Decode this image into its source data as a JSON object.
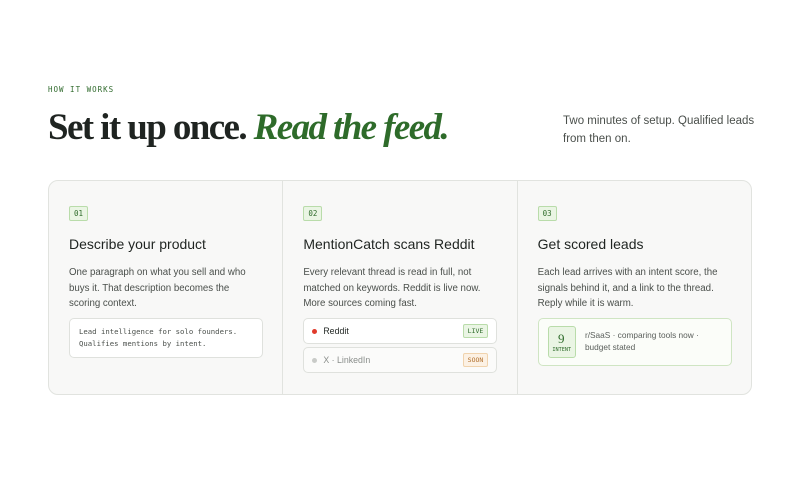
{
  "hero": {
    "eyebrow": "HOW IT WORKS",
    "title_plain": "Set it up once.",
    "title_accent": "Read the feed.",
    "subtext": "Two minutes of setup. Qualified leads from then on."
  },
  "steps": [
    {
      "number": "01",
      "title": "Describe your product",
      "description": "One paragraph on what you sell and who buys it. That description becomes the scoring context.",
      "example_line1": "Lead intelligence for solo founders.",
      "example_line2": "Qualifies mentions by intent."
    },
    {
      "number": "02",
      "title": "MentionCatch scans Reddit",
      "description": "Every relevant thread is read in full, not matched on keywords. Reddit is live now. More sources coming fast.",
      "sources": [
        {
          "label": "Reddit",
          "status": "LIVE"
        },
        {
          "label": "X · LinkedIn",
          "status": "SOON"
        }
      ]
    },
    {
      "number": "03",
      "title": "Get scored leads",
      "description": "Each lead arrives with an intent score, the signals behind it, and a link to the thread. Reply while it is warm.",
      "lead": {
        "score": "9",
        "score_label": "INTENT",
        "text": "r/SaaS · comparing tools now · budget stated"
      }
    }
  ],
  "colors": {
    "accent": "#2e6b2a",
    "live_dot": "#e03a2b",
    "soon": "#b06f2c"
  }
}
